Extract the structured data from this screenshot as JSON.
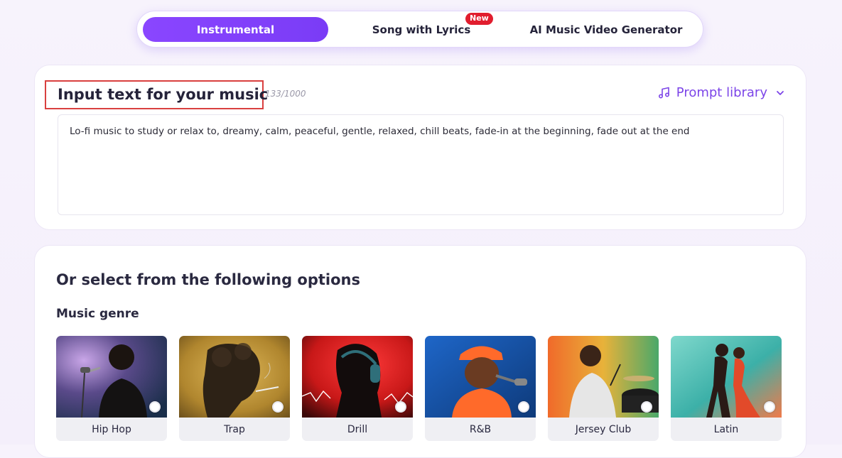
{
  "tabs": [
    {
      "label": "Instrumental",
      "active": true
    },
    {
      "label": "Song with Lyrics",
      "active": false,
      "badge": "New"
    },
    {
      "label": "AI Music Video Generator",
      "active": false
    }
  ],
  "input": {
    "title": "Input text for your music",
    "char_count": "133/1000",
    "prompt_library_label": "Prompt library",
    "text": "Lo-fi music to study or relax to, dreamy, calm, peaceful, gentle, relaxed, chill beats, fade-in at the beginning, fade out at the end"
  },
  "options": {
    "title": "Or select from the following options",
    "genre_label": "Music genre",
    "genres": [
      {
        "name": "Hip Hop",
        "icon": "hip-hop-image"
      },
      {
        "name": "Trap",
        "icon": "trap-image"
      },
      {
        "name": "Drill",
        "icon": "drill-image"
      },
      {
        "name": "R&B",
        "icon": "rnb-image"
      },
      {
        "name": "Jersey Club",
        "icon": "jersey-club-image"
      },
      {
        "name": "Latin",
        "icon": "latin-image"
      }
    ]
  },
  "colors": {
    "accent": "#7c45e8",
    "tab_active": "#8a46ff",
    "badge": "#e11d2e",
    "highlight_border": "#d9403f"
  }
}
